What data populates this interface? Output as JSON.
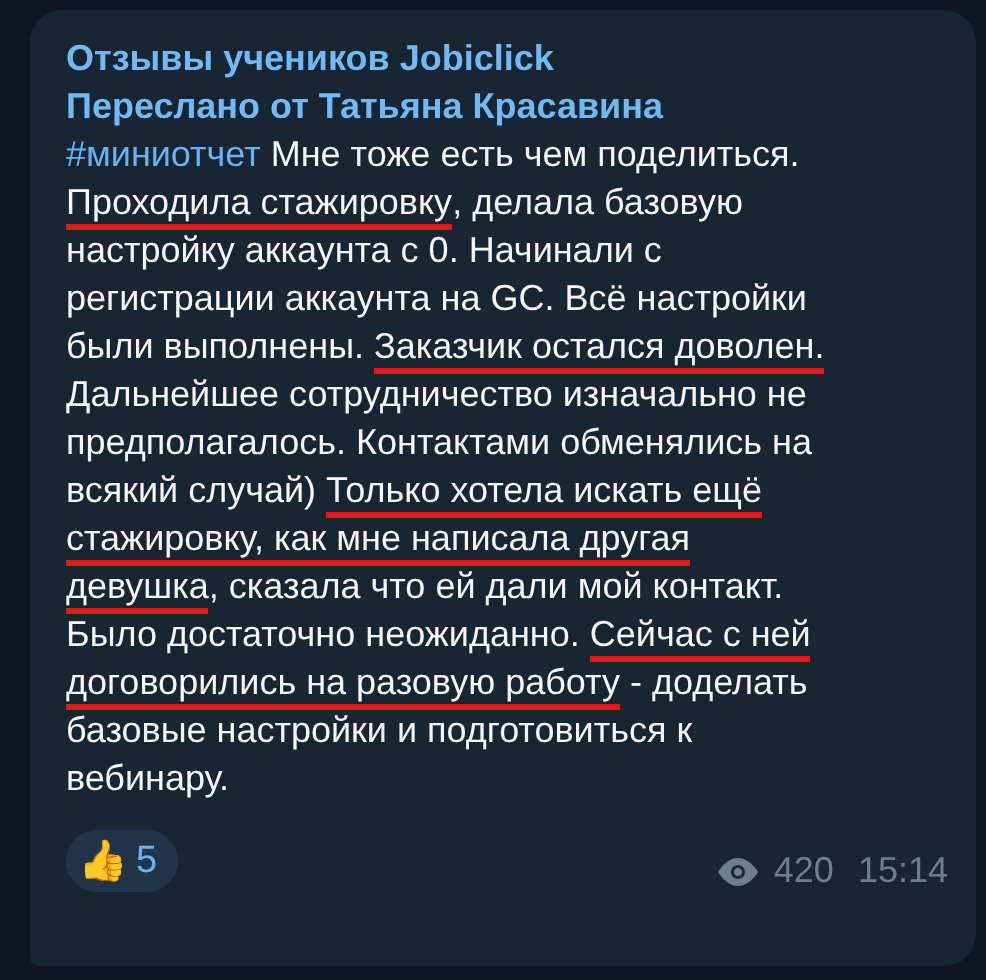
{
  "channel": {
    "name": "Отзывы учеников Jobiclick",
    "forwarded": "Переслано от Татьяна Красавина"
  },
  "lines": [
    [
      {
        "kind": "hashtag",
        "text": "#миниотчет",
        "underlined": false
      },
      {
        "kind": "text",
        "text": " Мне тоже есть чем поделиться.",
        "underlined": false
      }
    ],
    [
      {
        "kind": "text",
        "text": "Проходила стажировку",
        "underlined": true
      },
      {
        "kind": "text",
        "text": ", делала базовую",
        "underlined": false
      }
    ],
    [
      {
        "kind": "text",
        "text": "настройку аккаунта с 0. Начинали с",
        "underlined": false
      }
    ],
    [
      {
        "kind": "text",
        "text": "регистрации аккаунта на GC. Всё настройки",
        "underlined": false
      }
    ],
    [
      {
        "kind": "text",
        "text": "были выполнены. ",
        "underlined": false
      },
      {
        "kind": "text",
        "text": "Заказчик остался доволен.",
        "underlined": true
      }
    ],
    [
      {
        "kind": "text",
        "text": "Дальнейшее сотрудничество изначально не",
        "underlined": false
      }
    ],
    [
      {
        "kind": "text",
        "text": "предполагалось. Контактами обменялись на",
        "underlined": false
      }
    ],
    [
      {
        "kind": "text",
        "text": "всякий случай) ",
        "underlined": false
      },
      {
        "kind": "text",
        "text": "Только хотела искать ещё",
        "underlined": true
      }
    ],
    [
      {
        "kind": "text",
        "text": "стажировку, как мне написала другая",
        "underlined": true
      }
    ],
    [
      {
        "kind": "text",
        "text": "девушка",
        "underlined": true
      },
      {
        "kind": "text",
        "text": ", сказала что ей дали мой контакт.",
        "underlined": false
      }
    ],
    [
      {
        "kind": "text",
        "text": "Было достаточно неожиданно. ",
        "underlined": false
      },
      {
        "kind": "text",
        "text": "Сейчас с ней",
        "underlined": true
      }
    ],
    [
      {
        "kind": "text",
        "text": "договорились на разовую работу",
        "underlined": true
      },
      {
        "kind": "text",
        "text": " - доделать",
        "underlined": false
      }
    ],
    [
      {
        "kind": "text",
        "text": "базовые настройки и подготовиться к",
        "underlined": false
      }
    ],
    [
      {
        "kind": "text",
        "text": "вебинару.",
        "underlined": false
      }
    ]
  ],
  "reaction": {
    "emoji": "👍",
    "count": "5"
  },
  "views": "420",
  "time": "15:14"
}
